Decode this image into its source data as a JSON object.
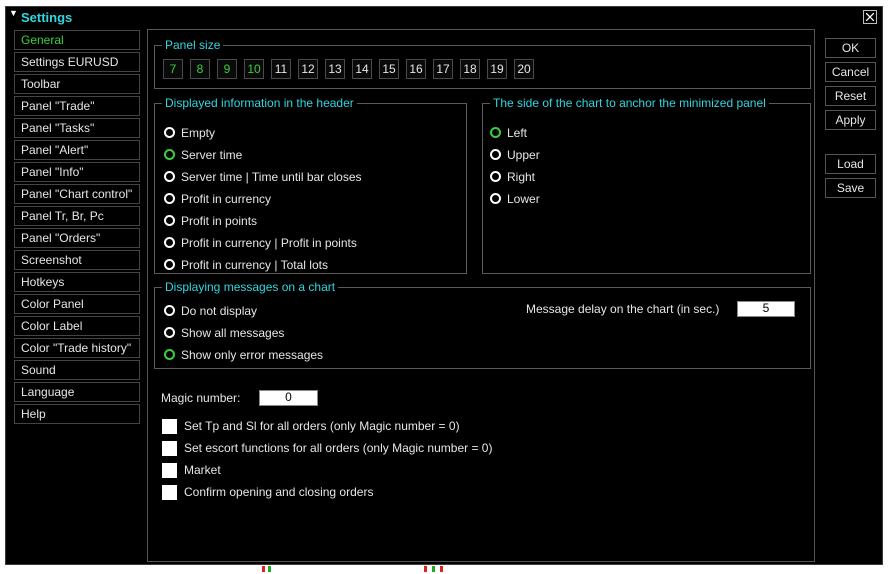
{
  "window": {
    "title": "Settings"
  },
  "sidebar": {
    "items": [
      {
        "label": "General",
        "active": true
      },
      {
        "label": "Settings EURUSD"
      },
      {
        "label": "Toolbar"
      },
      {
        "label": "Panel \"Trade\""
      },
      {
        "label": "Panel \"Tasks\""
      },
      {
        "label": "Panel \"Alert\""
      },
      {
        "label": "Panel \"Info\""
      },
      {
        "label": "Panel \"Chart control\""
      },
      {
        "label": "Panel Tr, Br, Pc"
      },
      {
        "label": "Panel \"Orders\""
      },
      {
        "label": "Screenshot"
      },
      {
        "label": "Hotkeys"
      },
      {
        "label": "Color Panel"
      },
      {
        "label": "Color Label"
      },
      {
        "label": "Color \"Trade history\""
      },
      {
        "label": "Sound"
      },
      {
        "label": "Language"
      },
      {
        "label": "Help"
      }
    ]
  },
  "panel_size": {
    "title": "Panel size",
    "sizes": [
      "7",
      "8",
      "9",
      "10",
      "11",
      "12",
      "13",
      "14",
      "15",
      "16",
      "17",
      "18",
      "19",
      "20"
    ],
    "green": [
      "7",
      "8",
      "9",
      "10"
    ]
  },
  "header_info": {
    "title": "Displayed information in the header",
    "options": [
      {
        "label": "Empty",
        "selected": false
      },
      {
        "label": "Server time",
        "selected": true
      },
      {
        "label": "Server time | Time until bar closes",
        "selected": false
      },
      {
        "label": "Profit in currency",
        "selected": false
      },
      {
        "label": "Profit in points",
        "selected": false
      },
      {
        "label": "Profit in currency | Profit in points",
        "selected": false
      },
      {
        "label": "Profit in currency | Total lots",
        "selected": false
      }
    ]
  },
  "anchor_side": {
    "title": "The side of the chart to anchor the minimized panel",
    "options": [
      {
        "label": "Left",
        "selected": true
      },
      {
        "label": "Upper",
        "selected": false
      },
      {
        "label": "Right",
        "selected": false
      },
      {
        "label": "Lower",
        "selected": false
      }
    ]
  },
  "messages": {
    "title": "Displaying messages on a chart",
    "options": [
      {
        "label": "Do not display",
        "selected": false
      },
      {
        "label": "Show all messages",
        "selected": false
      },
      {
        "label": "Show only error messages",
        "selected": true
      }
    ],
    "delay_label": "Message delay on the chart (in sec.)",
    "delay_value": "5"
  },
  "magic": {
    "label": "Magic number:",
    "value": "0"
  },
  "checks": [
    {
      "label": "Set Tp and Sl for all orders (only Magic number = 0)",
      "checked": false
    },
    {
      "label": "Set escort functions for all orders (only Magic number = 0)",
      "checked": false
    },
    {
      "label": "Market",
      "checked": false
    },
    {
      "label": "Confirm opening and closing orders",
      "checked": false
    }
  ],
  "buttons": {
    "ok": "OK",
    "cancel": "Cancel",
    "reset": "Reset",
    "apply": "Apply",
    "load": "Load",
    "save": "Save"
  },
  "colors": {
    "accent": "#2fd6e0",
    "selected": "#3ad03a"
  }
}
